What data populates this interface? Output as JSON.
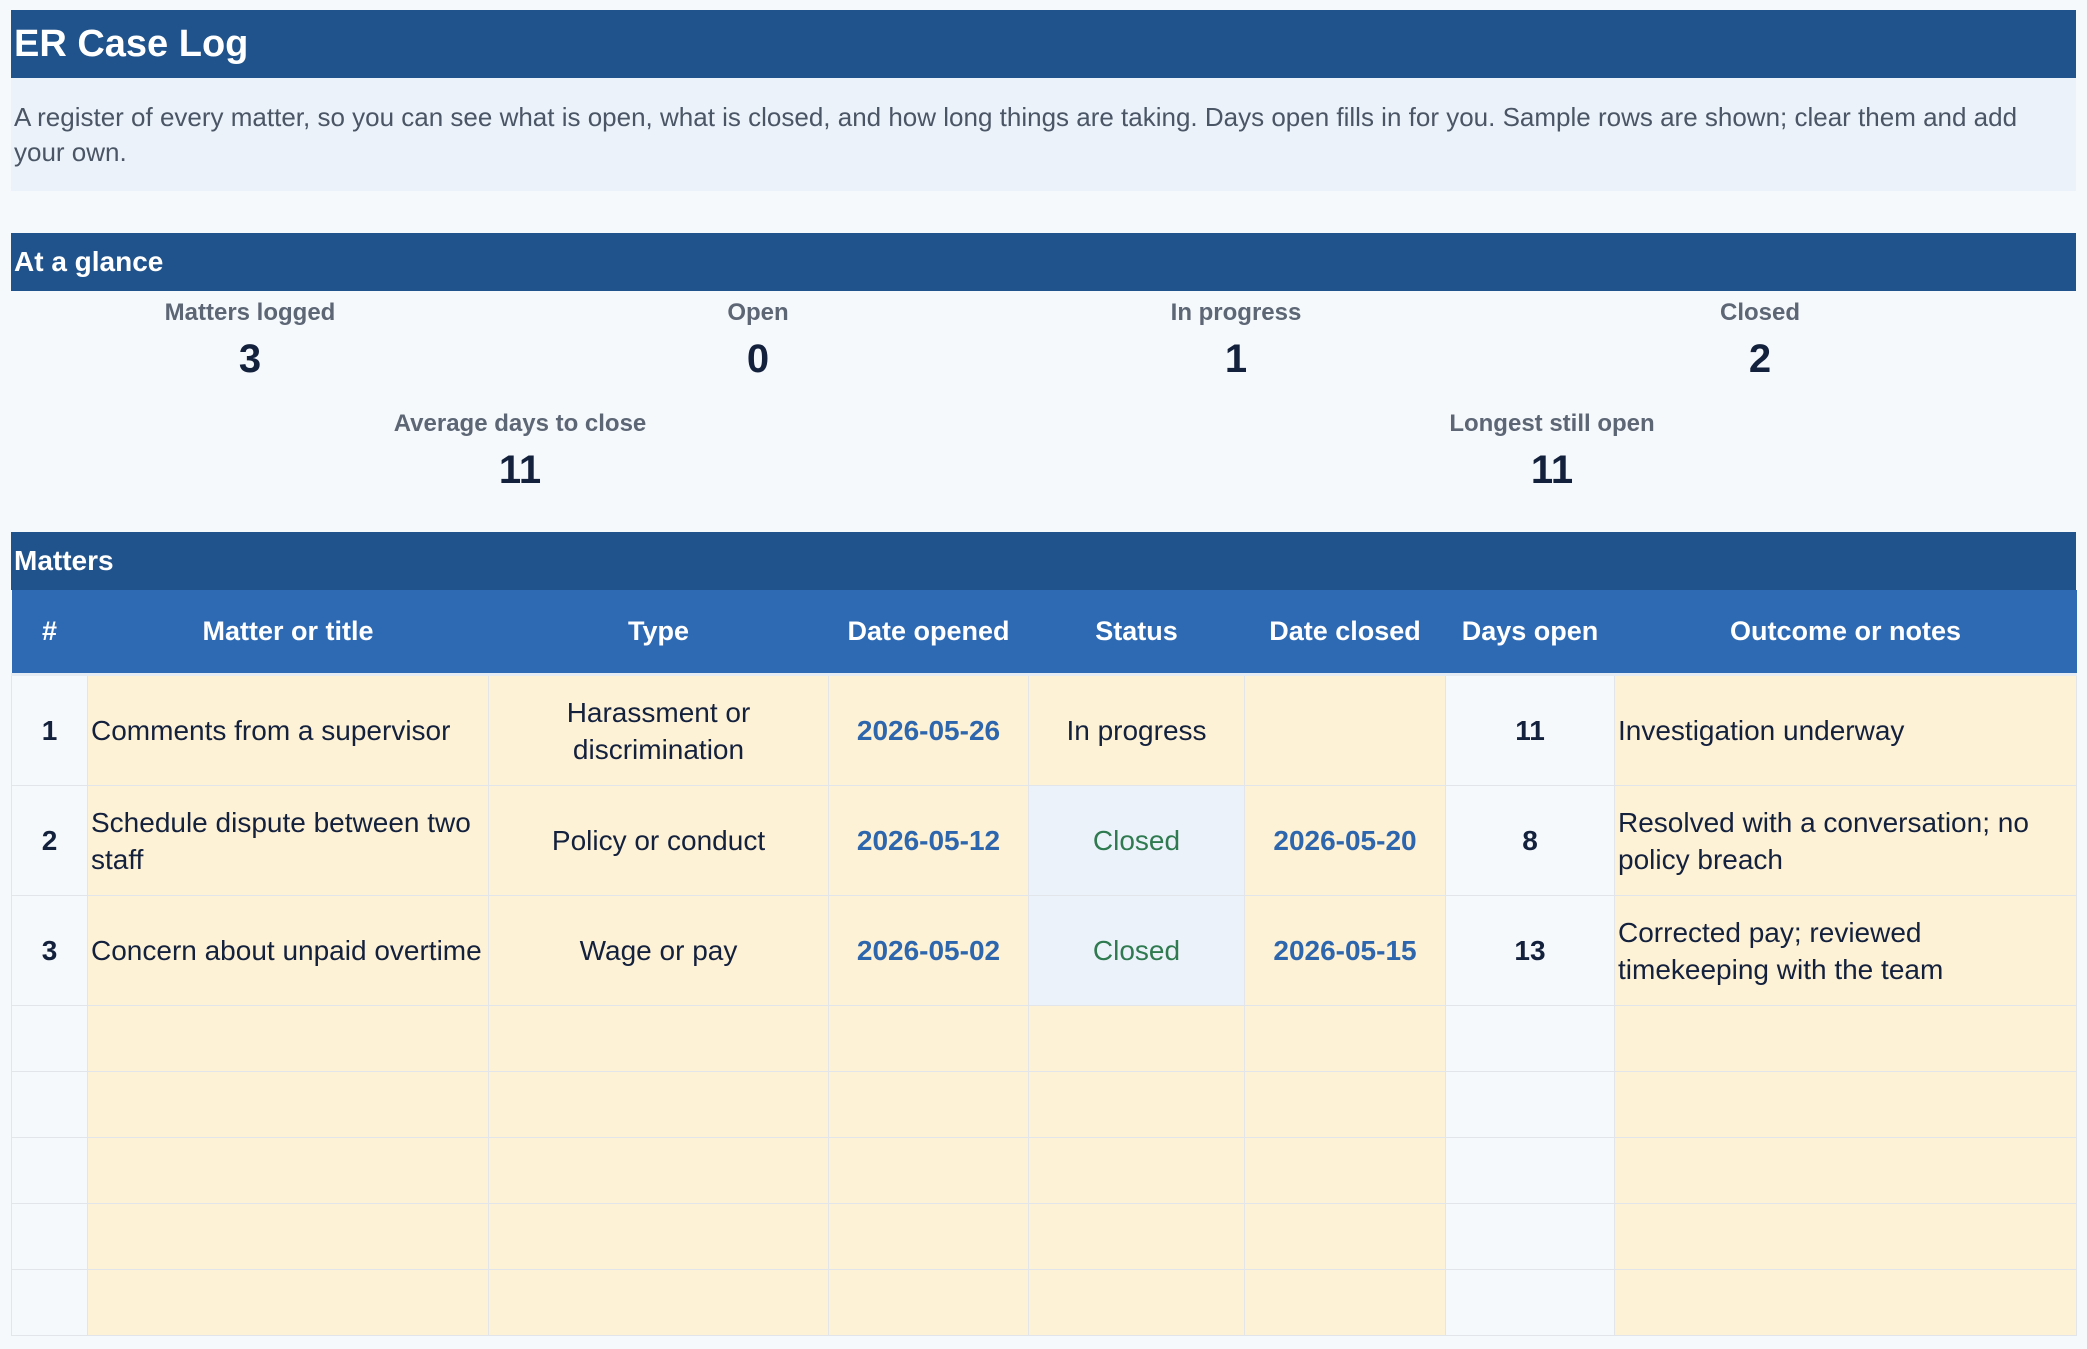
{
  "title": "ER Case Log",
  "description": "A register of every matter, so you can see what is open, what is closed, and how long things are taking. Days open fills in for you. Sample rows are shown; clear them and add your own.",
  "glance": {
    "heading": "At a glance",
    "stats": [
      {
        "label": "Matters logged",
        "value": "3"
      },
      {
        "label": "Open",
        "value": "0"
      },
      {
        "label": "In progress",
        "value": "1"
      },
      {
        "label": "Closed",
        "value": "2"
      },
      {
        "label": "Average days to close",
        "value": "11"
      },
      {
        "label": "Longest still open",
        "value": "11"
      }
    ]
  },
  "matters": {
    "heading": "Matters",
    "columns": [
      "#",
      "Matter or title",
      "Type",
      "Date opened",
      "Status",
      "Date closed",
      "Days open",
      "Outcome or notes"
    ],
    "rows": [
      {
        "num": "1",
        "title": "Comments from a supervisor",
        "type": "Harassment or discrimination",
        "opened": "2026-05-26",
        "status": "In progress",
        "closed": "",
        "days": "11",
        "notes": "Investigation underway"
      },
      {
        "num": "2",
        "title": "Schedule dispute between two staff",
        "type": "Policy or conduct",
        "opened": "2026-05-12",
        "status": "Closed",
        "closed": "2026-05-20",
        "days": "8",
        "notes": "Resolved with a conversation; no policy breach"
      },
      {
        "num": "3",
        "title": "Concern about unpaid overtime",
        "type": "Wage or pay",
        "opened": "2026-05-02",
        "status": "Closed",
        "closed": "2026-05-15",
        "days": "13",
        "notes": "Corrected pay; reviewed timekeeping with the team"
      }
    ],
    "empty_rows": 5
  },
  "colors": {
    "header_bar": "#20538c",
    "column_header": "#2e6ab4",
    "input_cell": "#fdf1d6",
    "closed_status": "#2f7a50",
    "date_text": "#2e66ad"
  }
}
